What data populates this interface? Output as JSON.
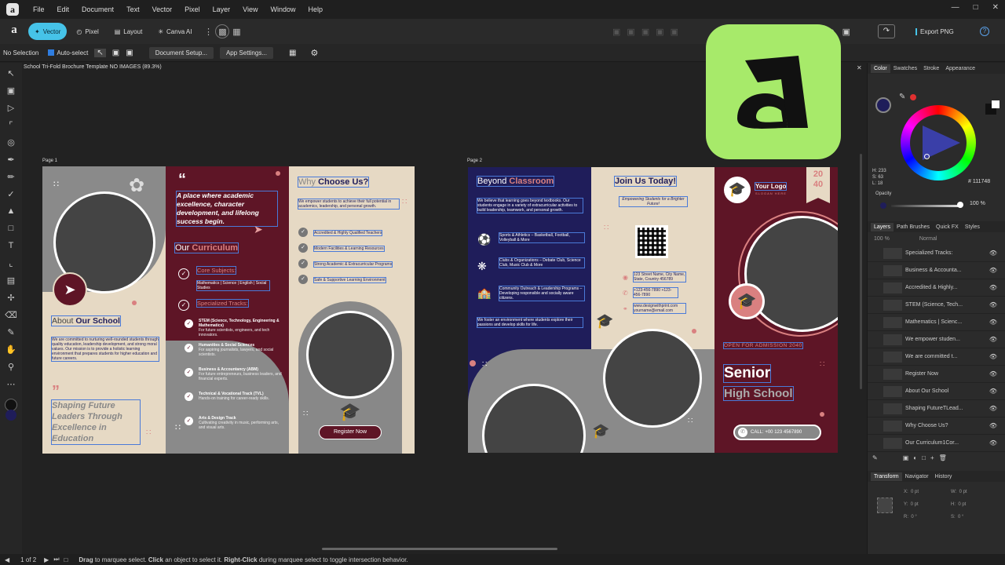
{
  "menu": [
    "File",
    "Edit",
    "Document",
    "Text",
    "Vector",
    "Pixel",
    "Layer",
    "View",
    "Window",
    "Help"
  ],
  "toolbar": {
    "personas": [
      "Vector",
      "Pixel",
      "Layout",
      "Canva AI"
    ],
    "export_label": "Export PNG"
  },
  "context": {
    "selection": "No Selection",
    "auto_select": "Auto-select",
    "doc_setup": "Document Setup...",
    "app_settings": "App Settings..."
  },
  "doc_title": "School Tri-Fold Brochure Template NO IMAGES (89.3%)",
  "pages": {
    "p1": "Page 1",
    "p2": "Page 2"
  },
  "brochure1": {
    "quote_mark": "“",
    "quote": "A place where academic excellence, character development, and lifelong success begin.",
    "curr_a": "Our ",
    "curr_b": "Curriculum",
    "core_title": "Core Subjects:",
    "core_text": "Mathematics | Science | English | Social Studies",
    "spec_title": "Specialized Tracks:",
    "tracks": [
      {
        "t": "STEM (Science, Technology, Engineering & Mathematics)",
        "d": "For future scientists, engineers, and tech innovators."
      },
      {
        "t": "Humanities & Social Sciences",
        "d": "For aspiring journalists, lawyers, and social scientists."
      },
      {
        "t": "Business & Accountancy (ABM)",
        "d": "For future entrepreneurs, business leaders, and financial experts."
      },
      {
        "t": "Technical & Vocational Track (TVL)",
        "d": "Hands-on training for career-ready skills."
      },
      {
        "t": "Arts & Design Track",
        "d": "Cultivating creativity in music, performing arts, and visual arts."
      }
    ],
    "about_a": "About ",
    "about_b": "Our School",
    "about_text": "We are committed to nurturing well-rounded students through quality education, leadership development, and strong moral values. Our mission is to provide a holistic learning environment that prepares students for higher education and future careers.",
    "shaping": "Shaping Future Leaders Through Excellence in Education",
    "why_a": "Why ",
    "why_b": "Choose Us?",
    "why_text": "We empower students to achieve their full potential in academics, leadership, and personal growth.",
    "why_items": [
      "Accredited & Highly Qualified Teachers",
      "Modern Facilities & Learning Resources",
      "Strong Academic & Extracurricular Programs",
      "Safe & Supportive Learning Environment"
    ],
    "register": "Register Now"
  },
  "brochure2": {
    "beyond_a": "Beyond ",
    "beyond_b": "Classroom",
    "beyond_text": "We believe that learning goes beyond textbooks. Our students engage in a variety of extracurricular activities to build leadership, teamwork, and personal growth.",
    "acts": [
      "Sports & Athletics – Basketball, Football, Volleyball & More",
      "Clubs & Organizations – Debate Club, Science Club, Music Club & More",
      "Community Outreach & Leadership Programs – Developing responsible and socially aware citizens."
    ],
    "foster": "We foster an environment where students explore their passions and develop skills for life.",
    "join": "Join Us Today!",
    "empower": "Empowering Students for a Brighter Future!",
    "address": "123 Street Name, City Name, State, Country 456789",
    "phone": "+123-456-7890 +123-456-7890",
    "web": "www.designwithprint.com yourname@email.com",
    "logo": "Your Logo",
    "slogan": "SLOGAN HERE",
    "year_a": "20",
    "year_b": "40",
    "open": "OPEN FOR ADMISSION 2040",
    "senior": "Senior",
    "high": "High School",
    "call": "CALL: +00 123 4567890"
  },
  "color_panel": {
    "tabs": [
      "Color",
      "Swatches",
      "Stroke",
      "Appearance"
    ],
    "hex": "111748",
    "h": "H: 233",
    "s": "S: 63",
    "l": "L: 18",
    "opacity": "Opacity",
    "opacity_val": "100 %"
  },
  "layers_panel": {
    "tabs": [
      "Layers",
      "Path Brushes",
      "Quick FX",
      "Styles"
    ],
    "opacity": "100 %",
    "blend": "Normal",
    "items": [
      "Specialized Tracks:",
      "Business & Accounta...",
      "Accredited & Highly...",
      "STEM (Science, Tech...",
      "Mathematics | Scienc...",
      "We empower studen...",
      "We are committed t...",
      "Register Now",
      "About Our School",
      "Shaping FutureTLead...",
      "Why Choose Us?",
      "Our Curriculum1Cor..."
    ]
  },
  "transform_panel": {
    "tabs": [
      "Transform",
      "Navigator",
      "History"
    ],
    "x": "0 pt",
    "y": "0 pt",
    "w": "0 pt",
    "h": "0 pt",
    "r": "0 °",
    "s": "0 °"
  },
  "status": {
    "pages": "1 of 2",
    "hint_bold1": "Drag",
    "hint1": " to marquee select. ",
    "hint_bold2": "Click",
    "hint2": " an object to select it. ",
    "hint_bold3": "Right-Click",
    "hint3": " during marquee select to toggle intersection behavior."
  },
  "colors": {
    "maroon": "#5e1526",
    "navy": "#1f1d5a",
    "cream": "#e6d9c4",
    "pink": "#d98080",
    "accent": "#46c3e8",
    "appicon": "#a7ea6a"
  }
}
